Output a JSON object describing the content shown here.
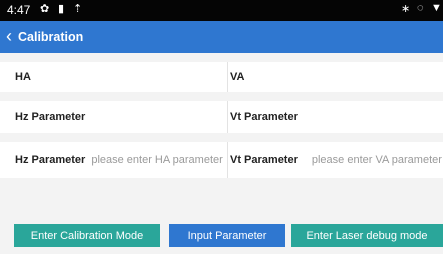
{
  "status_bar": {
    "time": "4:47",
    "icons": [
      "settings-icon",
      "battery-saver-icon",
      "upload-icon",
      "bluetooth-icon",
      "location-icon",
      "wifi-icon"
    ]
  },
  "app_bar": {
    "title": "Calibration",
    "back_icon": "chevron-left-icon"
  },
  "rows": [
    {
      "left": "HA",
      "right": "VA"
    },
    {
      "left": "Hz Parameter",
      "right": "Vt Parameter"
    },
    {
      "left": "Hz Parameter",
      "left_placeholder": "please enter HA parameter",
      "right": "Vt Parameter",
      "right_placeholder": "please enter VA parameter"
    }
  ],
  "buttons": {
    "calibration": "Enter Calibration Mode",
    "input_param": "Input Parameter",
    "laser": "Enter Laser debug mode"
  },
  "colors": {
    "app_bar": "#2f77d0",
    "calibration_button": "#2aa69a",
    "input_button": "#2f77d0",
    "laser_button": "#2aa69a"
  }
}
